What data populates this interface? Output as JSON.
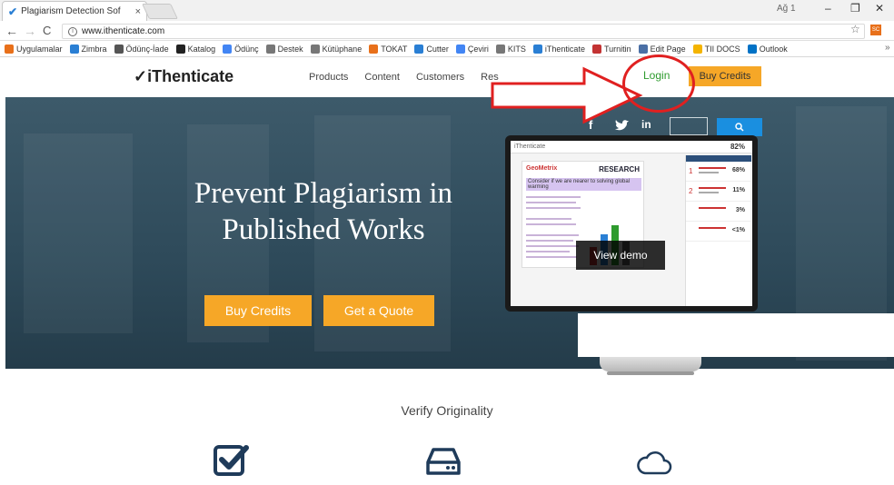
{
  "browser": {
    "tab_title": "Plagiarism Detection Sof",
    "tab_close": "×",
    "profile_label": "Ağ 1",
    "url": "www.ithenticate.com",
    "extension_label": "SC",
    "bookmarks": [
      {
        "label": "Uygulamalar",
        "icon": "apps-grid-icon",
        "color": "#e8701a"
      },
      {
        "label": "Zimbra",
        "icon": "zimbra-icon",
        "color": "#2a7fd4"
      },
      {
        "label": "Ödünç-İade",
        "icon": "swap-arrow-icon",
        "color": "#555555"
      },
      {
        "label": "Katalog",
        "icon": "katalog-icon",
        "color": "#222222"
      },
      {
        "label": "Ödünç",
        "icon": "google-icon",
        "color": "#4285f4"
      },
      {
        "label": "Destek",
        "icon": "page-icon",
        "color": "#777777"
      },
      {
        "label": "Kütüphane",
        "icon": "page-icon",
        "color": "#777777"
      },
      {
        "label": "TOKAT",
        "icon": "tokat-icon",
        "color": "#e8701a"
      },
      {
        "label": "Cutter",
        "icon": "cutter-icon",
        "color": "#2a7fd4"
      },
      {
        "label": "Çeviri",
        "icon": "translate-icon",
        "color": "#4285f4"
      },
      {
        "label": "KITS",
        "icon": "page-icon",
        "color": "#777777"
      },
      {
        "label": "iThenticate",
        "icon": "check-icon",
        "color": "#2a7fd4"
      },
      {
        "label": "Turnitin",
        "icon": "turnitin-icon",
        "color": "#c33333"
      },
      {
        "label": "Edit Page",
        "icon": "edit-page-icon",
        "color": "#4a6fa5"
      },
      {
        "label": "TII DOCS",
        "icon": "drive-icon",
        "color": "#f4b400"
      },
      {
        "label": "Outlook",
        "icon": "outlook-icon",
        "color": "#0072c6"
      }
    ],
    "bookmarks_more": "»"
  },
  "site": {
    "logo": "iThenticate",
    "nav": [
      "Products",
      "Content",
      "Customers",
      "Res"
    ],
    "login": "Login",
    "buy_credits_header": "Buy Credits",
    "social": [
      "f",
      "in"
    ],
    "search_button": "🔍",
    "headline_line1": "Prevent Plagiarism in",
    "headline_line2": "Published Works",
    "buy_credits": "Buy Credits",
    "get_quote": "Get a Quote",
    "view_demo": "View demo",
    "verify_title": "Verify Originality"
  },
  "mock_screen": {
    "app_name": "iThenticate",
    "score": "82%",
    "brand": "GeoMetrix",
    "research": "RESEARCH",
    "highlight_text": "Consider if we are nearer to solving global warming",
    "matches": [
      {
        "num": "1",
        "pct": "68%"
      },
      {
        "num": "2",
        "pct": "11%"
      },
      {
        "num": "",
        "pct": "3%"
      },
      {
        "num": "",
        "pct": "<1%"
      }
    ]
  },
  "colors": {
    "accent": "#f6a727",
    "login_green": "#2e9b2e",
    "search_blue": "#1a8fe0",
    "hero_bg": "#2e4a5a",
    "annotation_red": "#e02020"
  }
}
